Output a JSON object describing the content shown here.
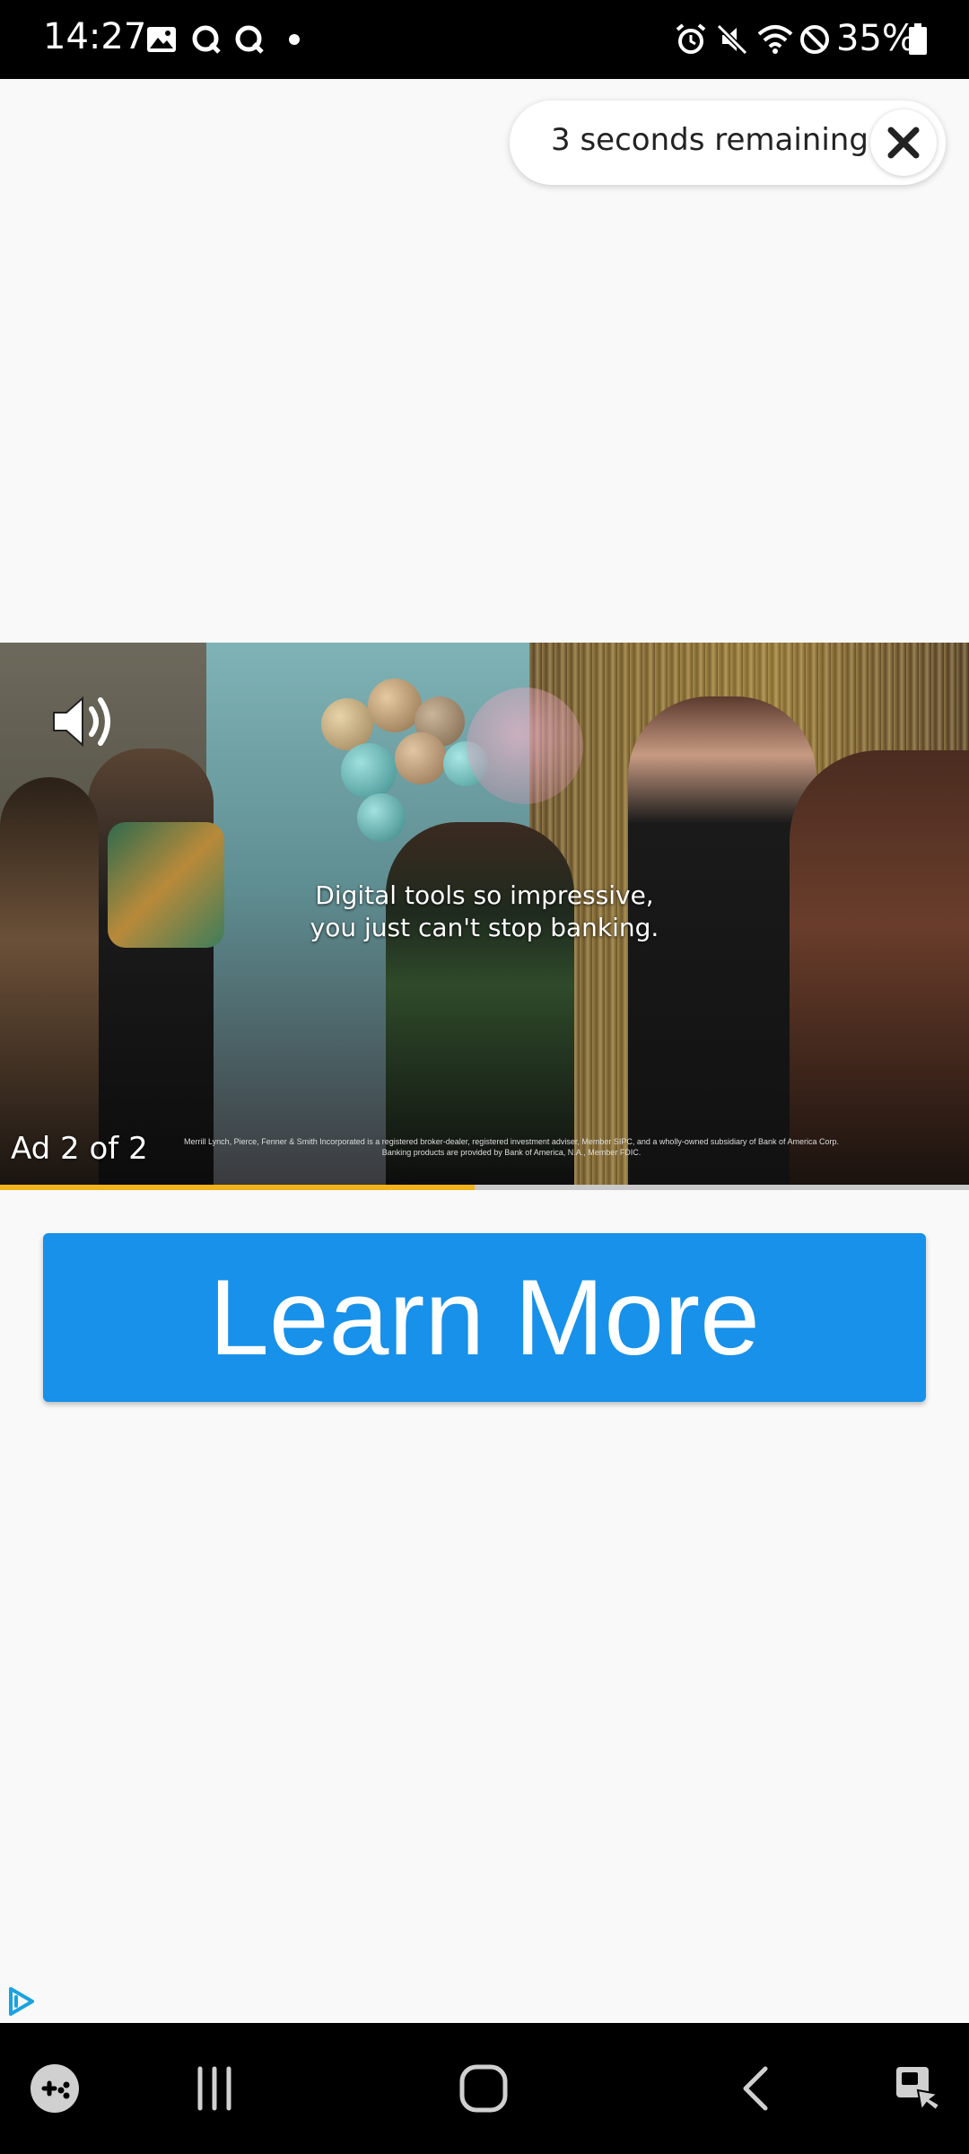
{
  "status_bar": {
    "time": "14:27",
    "battery": "35%",
    "icons": [
      "gallery-icon",
      "q-app-icon",
      "q-app-icon",
      "dot-icon",
      "alarm-icon",
      "mute-icon",
      "wifi-icon",
      "do-not-disturb-icon",
      "battery-icon"
    ]
  },
  "countdown": {
    "text": "3 seconds remaining",
    "close_icon": "close-icon"
  },
  "video": {
    "caption_line1": "Digital tools so impressive,",
    "caption_line2": "you just can't stop banking.",
    "disclaimer_line1": "Merrill Lynch, Pierce, Fenner & Smith Incorporated is a registered broker-dealer, registered investment adviser, Member SIPC, and a wholly-owned subsidiary of Bank of America Corp.",
    "disclaimer_line2": "Banking products are provided by Bank of America, N.A., Member FDIC.",
    "ad_counter": "Ad 2 of 2",
    "mute_icon": "speaker-icon",
    "progress": 0.49,
    "progress_color": "#f2b21a"
  },
  "cta": {
    "label": "Learn More",
    "color": "#1791ea"
  },
  "adchoices_icon": "adchoices-icon",
  "nav_bar": {
    "icons": [
      "game-launcher-icon",
      "recent-apps-icon",
      "home-icon",
      "back-icon",
      "accessibility-icon"
    ]
  }
}
